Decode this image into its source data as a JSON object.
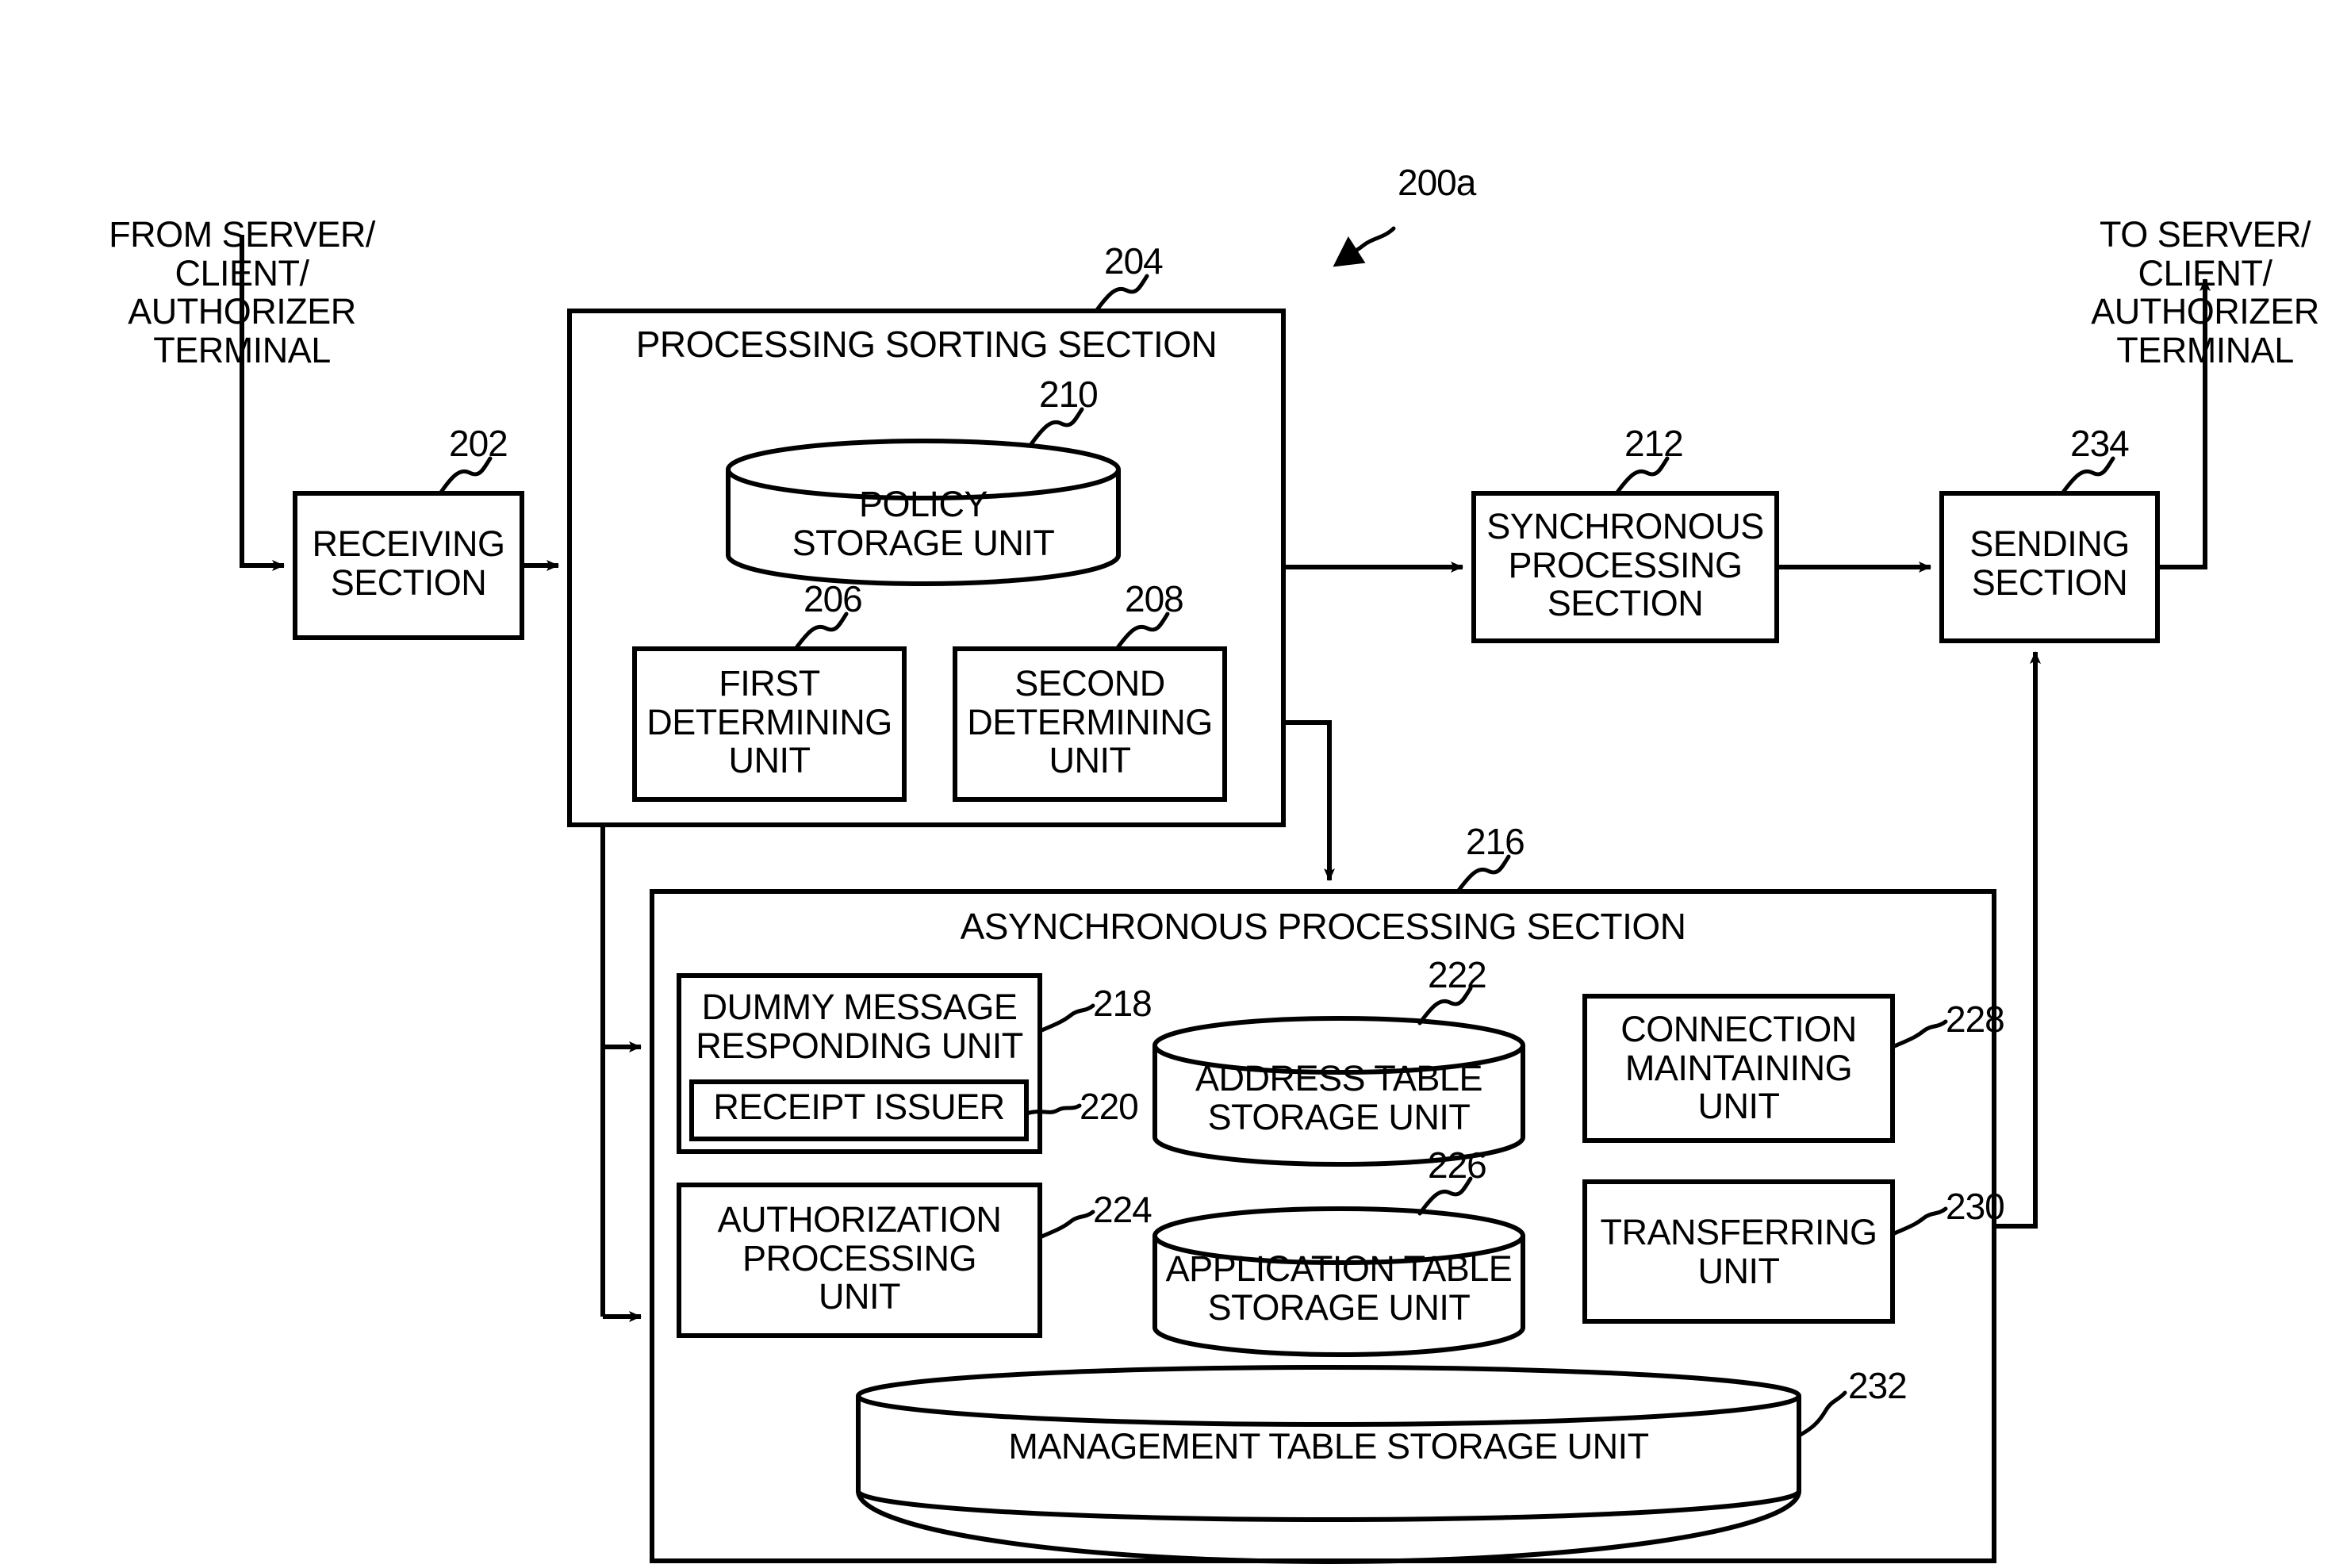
{
  "figure": {
    "system_ref": "200a",
    "input_label": "FROM SERVER/\nCLIENT/\nAUTHORIZER\nTERMINAL",
    "output_label": "TO SERVER/\nCLIENT/\nAUTHORIZER\nTERMINAL"
  },
  "blocks": {
    "receiving_section": {
      "label": "RECEIVING\nSECTION",
      "ref": "202"
    },
    "processing_sorting_section": {
      "label": "PROCESSING SORTING SECTION",
      "ref": "204"
    },
    "first_determining_unit": {
      "label": "FIRST\nDETERMINING\nUNIT",
      "ref": "206"
    },
    "second_determining_unit": {
      "label": "SECOND\nDETERMINING\nUNIT",
      "ref": "208"
    },
    "policy_storage_unit": {
      "label": "POLICY\nSTORAGE UNIT",
      "ref": "210"
    },
    "synchronous_processing_section": {
      "label": "SYNCHRONOUS\nPROCESSING\nSECTION",
      "ref": "212"
    },
    "asynchronous_processing_section": {
      "label": "ASYNCHRONOUS PROCESSING SECTION",
      "ref": "216"
    },
    "dummy_message_responding_unit": {
      "label": "DUMMY MESSAGE\nRESPONDING UNIT",
      "ref": "218"
    },
    "receipt_issuer": {
      "label": "RECEIPT ISSUER",
      "ref": "220"
    },
    "address_table_storage_unit": {
      "label": "ADDRESS TABLE\nSTORAGE UNIT",
      "ref": "222"
    },
    "authorization_processing_unit": {
      "label": "AUTHORIZATION\nPROCESSING\nUNIT",
      "ref": "224"
    },
    "application_table_storage_unit": {
      "label": "APPLICATION TABLE\nSTORAGE UNIT",
      "ref": "226"
    },
    "connection_maintaining_unit": {
      "label": "CONNECTION\nMAINTAINING\nUNIT",
      "ref": "228"
    },
    "transferring_unit": {
      "label": "TRANSFERRING\nUNIT",
      "ref": "230"
    },
    "management_table_storage_unit": {
      "label": "MANAGEMENT TABLE STORAGE UNIT",
      "ref": "232"
    },
    "sending_section": {
      "label": "SENDING\nSECTION",
      "ref": "234"
    }
  },
  "colors": {
    "stroke": "#000000",
    "fill": "#ffffff"
  }
}
